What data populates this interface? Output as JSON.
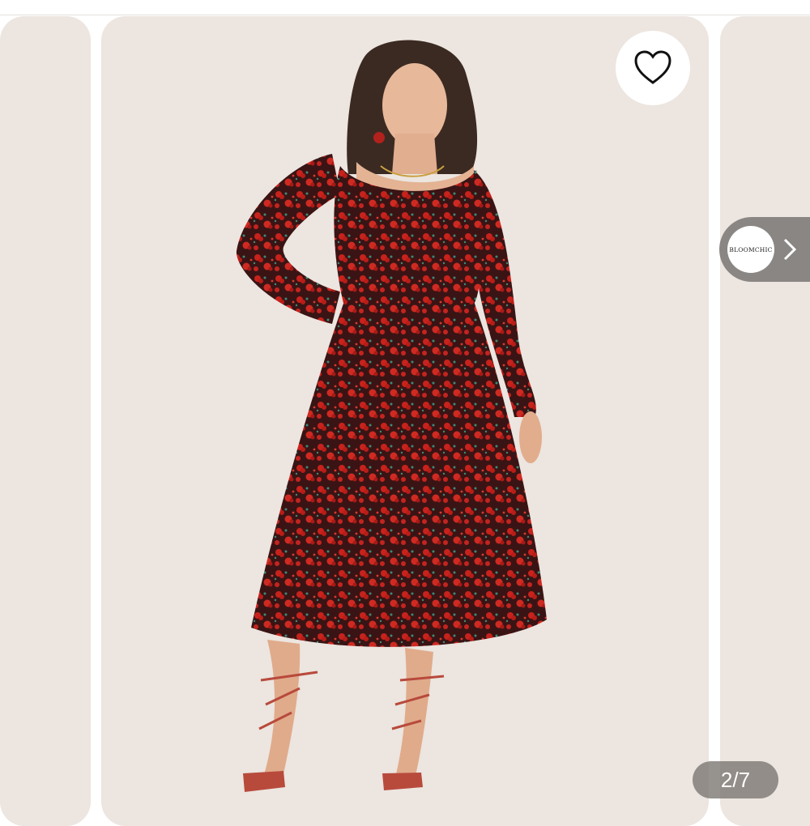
{
  "gallery": {
    "counter": "2/7",
    "store_badge": {
      "label": "BLOOMCHIC"
    },
    "icons": {
      "favorite": "heart-outline-icon",
      "next": "chevron-right-icon"
    },
    "colors": {
      "card_bg": "#ece5e0",
      "dress": "#7a1a1a",
      "flower": "#d1261f",
      "pill": "#8a8683"
    }
  }
}
